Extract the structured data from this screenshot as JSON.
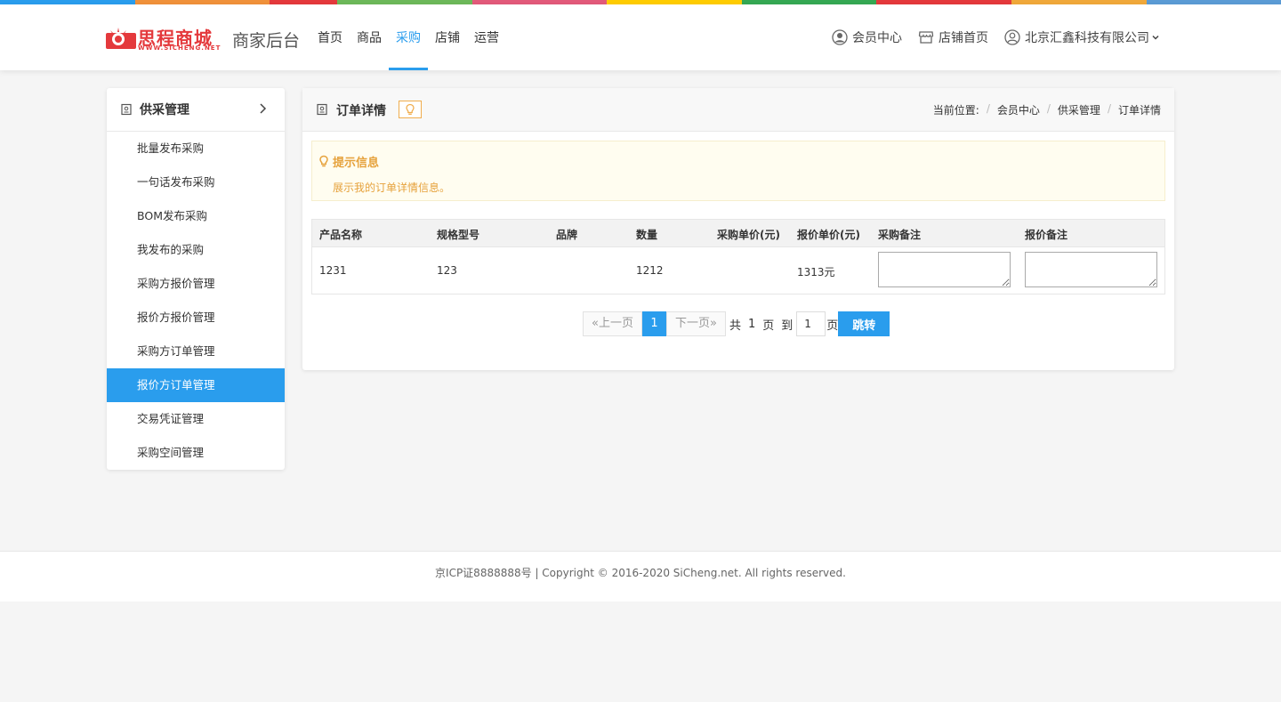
{
  "brand": {
    "logo_text": "思程商城",
    "logo_sub": "WWW.SICHENG.NET",
    "portal_title": "商家后台"
  },
  "colors": {
    "accent": "#2a9ded",
    "logo_red": "#e4393c",
    "tip": "#e6a23c",
    "rainbow": [
      "#2a9ded",
      "#f0913a",
      "#e4393c",
      "#6db85a",
      "#e25a7a",
      "#ffcc00",
      "#35a853",
      "#e4393c",
      "#f0a83a",
      "#5b9bd5"
    ]
  },
  "nav": {
    "items": [
      {
        "label": "首页",
        "active": false
      },
      {
        "label": "商品",
        "active": false
      },
      {
        "label": "采购",
        "active": true
      },
      {
        "label": "店铺",
        "active": false
      },
      {
        "label": "运营",
        "active": false
      }
    ]
  },
  "top_links": {
    "member_center": "会员中心",
    "store_home": "店铺首页",
    "company": "北京汇鑫科技有限公司"
  },
  "sidebar": {
    "title": "供采管理",
    "items": [
      {
        "label": "批量发布采购",
        "active": false
      },
      {
        "label": "一句话发布采购",
        "active": false
      },
      {
        "label": "BOM发布采购",
        "active": false
      },
      {
        "label": "我发布的采购",
        "active": false
      },
      {
        "label": "采购方报价管理",
        "active": false
      },
      {
        "label": "报价方报价管理",
        "active": false
      },
      {
        "label": "采购方订单管理",
        "active": false
      },
      {
        "label": "报价方订单管理",
        "active": true
      },
      {
        "label": "交易凭证管理",
        "active": false
      },
      {
        "label": "采购空间管理",
        "active": false
      }
    ]
  },
  "panel": {
    "title": "订单详情",
    "breadcrumb": {
      "prefix": "当前位置:",
      "items": [
        "会员中心",
        "供采管理",
        "订单详情"
      ]
    }
  },
  "tip": {
    "title": "提示信息",
    "text": "展示我的订单详情信息。"
  },
  "table": {
    "headers": [
      "产品名称",
      "规格型号",
      "品牌",
      "数量",
      "采购单价(元)",
      "报价单价(元)",
      "采购备注",
      "报价备注"
    ],
    "rows": [
      {
        "product_name": "1231",
        "spec": "123",
        "brand": "",
        "quantity": "1212",
        "purchase_price": "",
        "quote_price": "1313元",
        "purchase_note": "",
        "quote_note": ""
      }
    ]
  },
  "pager": {
    "prev": "«上一页",
    "current": "1",
    "next": "下一页»",
    "total_prefix": "共",
    "total_pages": "1",
    "total_suffix": "页",
    "goto_prefix": "到",
    "goto_value": "1",
    "goto_suffix": "页",
    "go_label": "跳转"
  },
  "footer": {
    "text": "京ICP证8888888号 | Copyright © 2016-2020 SiCheng.net. All rights reserved."
  }
}
